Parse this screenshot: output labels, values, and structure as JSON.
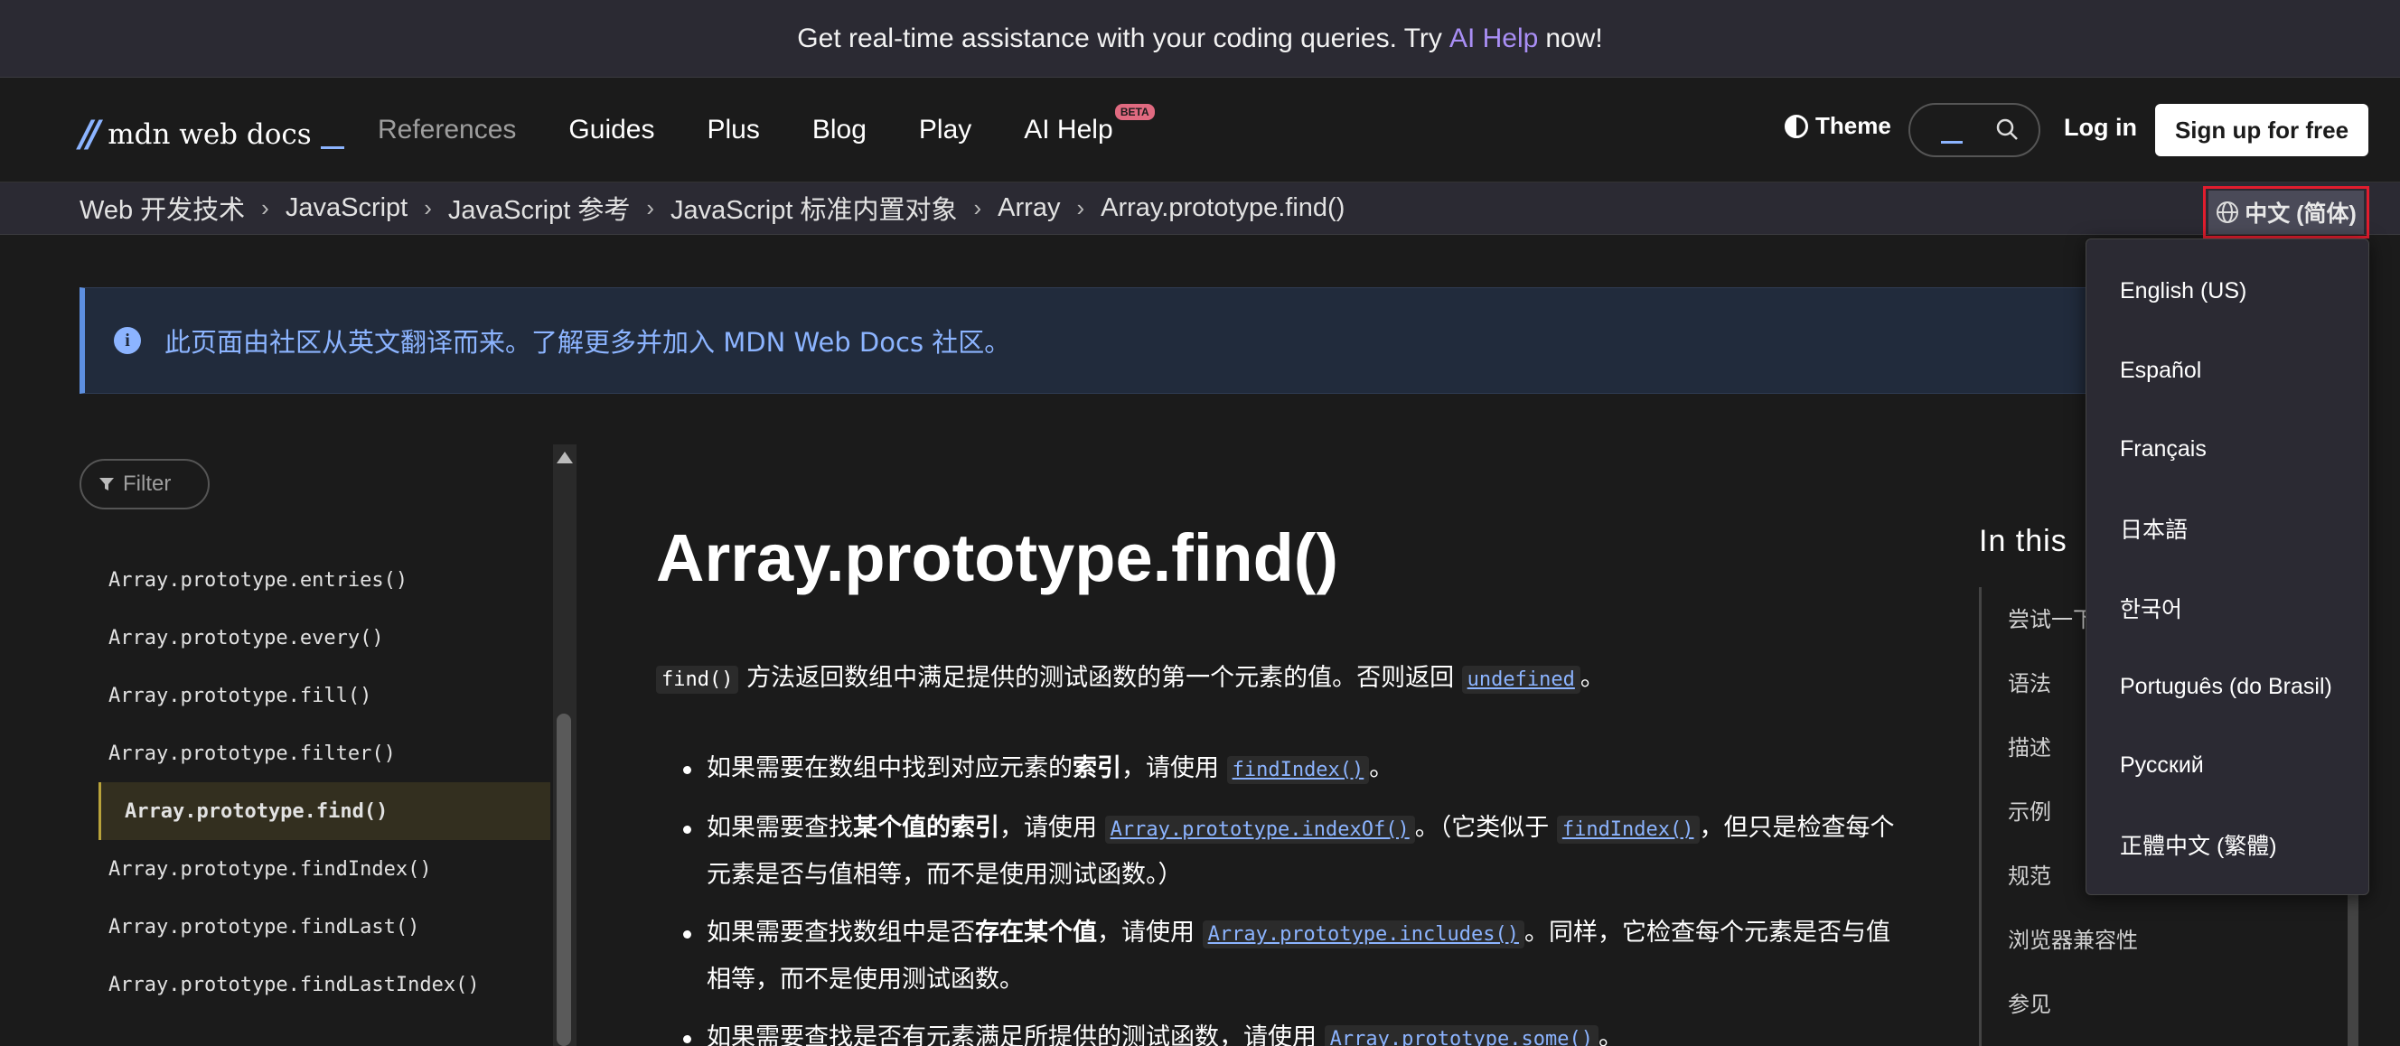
{
  "banner": {
    "text_before": "Get real-time assistance with your coding queries. Try",
    "link": "AI Help",
    "text_after": "now!"
  },
  "header": {
    "logo_mark": "//",
    "logo_text": "mdn web docs",
    "nav": [
      "References",
      "Guides",
      "Plus",
      "Blog",
      "Play",
      "AI Help"
    ],
    "beta": "BETA",
    "theme": "Theme",
    "login": "Log in",
    "signup": "Sign up for free",
    "icons": [
      "theme-icon",
      "search-icon"
    ]
  },
  "breadcrumbs": [
    "Web 开发技术",
    "JavaScript",
    "JavaScript 参考",
    "JavaScript 标准内置对象",
    "Array",
    "Array.prototype.find()"
  ],
  "language_button": "中文 (简体)",
  "notice": "此页面由社区从英文翻译而来。了解更多并加入 MDN Web Docs 社区。",
  "sidebar": {
    "filter": "Filter",
    "items": [
      "Array.prototype.entries()",
      "Array.prototype.every()",
      "Array.prototype.fill()",
      "Array.prototype.filter()",
      "Array.prototype.find()",
      "Array.prototype.findIndex()",
      "Array.prototype.findLast()",
      "Array.prototype.findLastIndex()"
    ],
    "active_index": 4
  },
  "main": {
    "title": "Array.prototype.find()",
    "lead_code": "find()",
    "lead_text": " 方法返回数组中满足提供的测试函数的第一个元素的值。否则返回 ",
    "lead_link": "undefined",
    "lead_end": "。",
    "b1": {
      "t1": "如果需要在数组中找到对应元素的",
      "strong": "索引",
      "t2": "，请使用 ",
      "code": "findIndex()",
      "t3": "。"
    },
    "b2": {
      "t1": "如果需要查找",
      "strong": "某个值的索引",
      "t2": "，请使用 ",
      "code1": "Array.prototype.indexOf()",
      "t3": "。（它类似于 ",
      "code2": "findIndex()",
      "t4": "，但只是检查每个元素是否与值相等，而不是使用测试函数。）"
    },
    "b3": {
      "t1": "如果需要查找数组中是否",
      "strong": "存在某个值",
      "t2": "，请使用 ",
      "code": "Array.prototype.includes()",
      "t3": "。同样，它检查每个元素是否与值相等，而不是使用测试函数。"
    },
    "b4": {
      "t1": "如果需要查找是否有元素满足所提供的测试函数，请使用 ",
      "code": "Array.prototype.some()",
      "t2": "。"
    }
  },
  "toc": {
    "title": "In this",
    "items": [
      "尝试一下",
      "语法",
      "描述",
      "示例",
      "规范",
      "浏览器兼容性",
      "参见"
    ]
  },
  "language_menu": [
    "English (US)",
    "Español",
    "Français",
    "日本語",
    "한국어",
    "Português (do Brasil)",
    "Русский",
    "正體中文 (繁體)"
  ]
}
